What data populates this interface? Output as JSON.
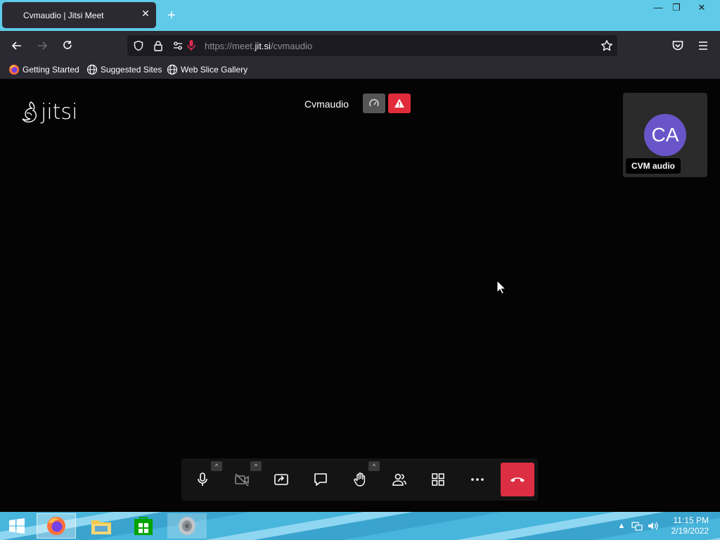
{
  "browser": {
    "tab_title": "Cvmaudio | Jitsi Meet",
    "url_prefix": "https://meet.",
    "url_domain": "jit.si",
    "url_path": "/cvmaudio",
    "bookmarks": [
      {
        "label": "Getting Started",
        "icon": "firefox-icon"
      },
      {
        "label": "Suggested Sites",
        "icon": "globe-icon"
      },
      {
        "label": "Web Slice Gallery",
        "icon": "globe-icon"
      }
    ]
  },
  "meeting": {
    "logo_text": "jitsi",
    "title": "Cvmaudio",
    "participant": {
      "initials": "CA",
      "name": "CVM audio",
      "avatar_color": "#6955c9"
    },
    "toolbar": [
      {
        "name": "microphone-button",
        "icon": "microphone-icon",
        "has_menu": true
      },
      {
        "name": "camera-button",
        "icon": "camera-off-icon",
        "has_menu": true
      },
      {
        "name": "screen-share-button",
        "icon": "screen-share-icon",
        "has_menu": false
      },
      {
        "name": "chat-button",
        "icon": "chat-icon",
        "has_menu": false
      },
      {
        "name": "raise-hand-button",
        "icon": "hand-icon",
        "has_menu": true
      },
      {
        "name": "participants-button",
        "icon": "participants-icon",
        "has_menu": false
      },
      {
        "name": "tile-view-button",
        "icon": "grid-icon",
        "has_menu": false
      },
      {
        "name": "more-actions-button",
        "icon": "more-icon",
        "has_menu": false
      }
    ],
    "hangup_color": "#dd2f43",
    "warning_color": "#e02b3a"
  },
  "taskbar": {
    "apps": [
      "windows-start-icon",
      "firefox-icon",
      "file-explorer-icon",
      "store-icon",
      "speaker-app-icon"
    ],
    "time": "11:15 PM",
    "date": "2/19/2022"
  },
  "colors": {
    "titlebar": "#5fcbe9",
    "browser_chrome": "#2b2a33"
  }
}
